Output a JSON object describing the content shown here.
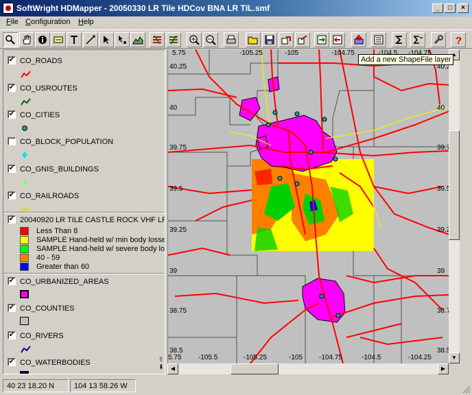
{
  "window": {
    "title": "SoftWright HDMapper - 20050330 LR Tile HDCov BNA LR TIL.smf",
    "min_glyph": "_",
    "max_glyph": "□",
    "close_glyph": "×"
  },
  "menu": [
    {
      "first": "F",
      "rest": "ile"
    },
    {
      "first": "C",
      "rest": "onfiguration"
    },
    {
      "first": "H",
      "rest": "elp"
    }
  ],
  "toolbar": {
    "tools": [
      "zoom-tool-icon",
      "pan-hand-icon",
      "info-icon",
      "label-icon",
      "text-tool-icon",
      "measure-line-icon",
      "select-arrow-icon",
      "select-feature-icon",
      "profile-icon",
      "layers-a-icon",
      "layers-b-icon",
      "zoom-in-icon",
      "zoom-out-icon",
      "print-icon",
      "open-folder-icon",
      "save-icon",
      "export-a-icon",
      "export-b-icon",
      "import-a-icon",
      "import-b-icon",
      "add-shapefile-layer-icon",
      "legend-list-icon",
      "sum-icon",
      "sum-arrow-icon",
      "wrench-icon",
      "help-icon"
    ],
    "tooltip": "Add a new ShapeFile layer"
  },
  "legend": {
    "layers": [
      {
        "name": "CO_ROADS",
        "checked": true,
        "symbol": "line",
        "color": "#ff0000"
      },
      {
        "name": "CO_USROUTES",
        "checked": true,
        "symbol": "line",
        "color": "#006000"
      },
      {
        "name": "CO_CITIES",
        "checked": true,
        "symbol": "dot",
        "color": "#20a0a0"
      },
      {
        "name": "CO_BLOCK_POPULATION",
        "checked": false,
        "symbol": "diamond",
        "color": "#00e0ff"
      },
      {
        "name": "CO_GNIS_BUILDINGS",
        "checked": true,
        "symbol": "diamond",
        "color": "#80ff80"
      },
      {
        "name": "CO_RAILROADS",
        "checked": true,
        "symbol": "line",
        "color": "#e0e000"
      }
    ],
    "coverage": {
      "name": "20040920 LR TILE CASTLE ROCK VHF LR",
      "checked": true,
      "classes": [
        {
          "label": "Less Than 8",
          "color": "#ff0000"
        },
        {
          "label": "SAMPLE Hand-held w/ min body losses",
          "color": "#ffff00"
        },
        {
          "label": "SAMPLE Hand-held w/ severe body los",
          "color": "#00ff00"
        },
        {
          "label": "40 - 59",
          "color": "#ff8000"
        },
        {
          "label": "Greater than 60",
          "color": "#0000ff"
        }
      ]
    },
    "layers2": [
      {
        "name": "CO_URBANIZED_AREAS",
        "checked": true,
        "symbol": "fillbox",
        "color": "#ff00ff"
      },
      {
        "name": "CO_COUNTIES",
        "checked": true,
        "symbol": "outlinebox",
        "color": "#c0c0c0"
      },
      {
        "name": "CO_RIVERS",
        "checked": true,
        "symbol": "line",
        "color": "#0000a0"
      },
      {
        "name": "CO_WATERBODIES",
        "checked": true,
        "symbol": "fillbox",
        "color": "#000080"
      }
    ],
    "arrows": [
      "⇧",
      "⬇"
    ]
  },
  "map": {
    "top_lon": [
      "5.75",
      "-105.25",
      "-105",
      "-104.75",
      "-104.5",
      "-104.25"
    ],
    "bottom_lon": [
      "5.75",
      "-105.5",
      "-105.25",
      "-105",
      "-104.75",
      "-104.5",
      "-104.25"
    ],
    "left_lat": [
      "40.25",
      "40",
      "39.75",
      "39.5",
      "39.25",
      "39",
      "38.75",
      "38.5"
    ],
    "right_lat": [
      "40.25",
      "40",
      "39.75",
      "39.5",
      "39.25",
      "39",
      "38.75",
      "38.5"
    ]
  },
  "status": {
    "lat": "40 23 18.20 N",
    "lon": "104 13 58.26 W"
  }
}
